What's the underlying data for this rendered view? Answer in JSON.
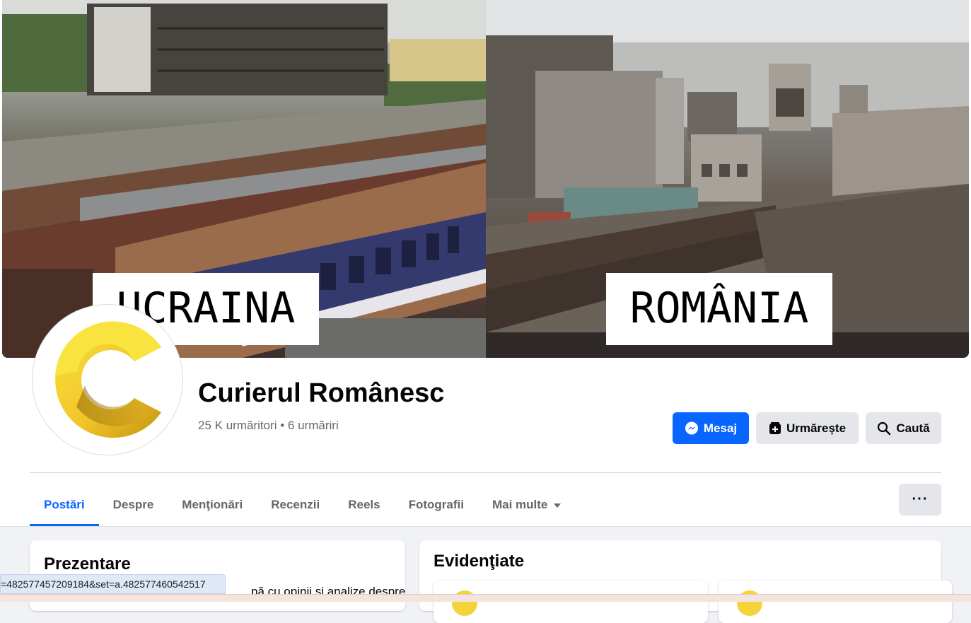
{
  "cover": {
    "left_label": "UCRAINA",
    "right_label": "ROMÂNIA"
  },
  "page": {
    "name": "Curierul Românesc",
    "followers": "25 K urmăritori",
    "separator": "•",
    "following": "6 urmăriri"
  },
  "actions": {
    "message_label": "Mesaj",
    "follow_label": "Urmărește",
    "search_label": "Caută",
    "more_label": "···"
  },
  "tabs": [
    {
      "label": "Postări",
      "active": true
    },
    {
      "label": "Despre"
    },
    {
      "label": "Menţionări"
    },
    {
      "label": "Recenzii"
    },
    {
      "label": "Reels"
    },
    {
      "label": "Fotografii"
    },
    {
      "label": "Mai multe"
    }
  ],
  "intro": {
    "title": "Prezentare",
    "text": "pă cu opinii și analize despre"
  },
  "highlights": {
    "title": "Evidenţiate"
  },
  "status_bar": {
    "url": "=482577457209184&set=a.482577460542517"
  },
  "colors": {
    "brand_blue": "#0866ff",
    "button_gray": "#e4e6eb",
    "logo_yellow": "#f7d93a",
    "logo_gold": "#c4950e"
  }
}
